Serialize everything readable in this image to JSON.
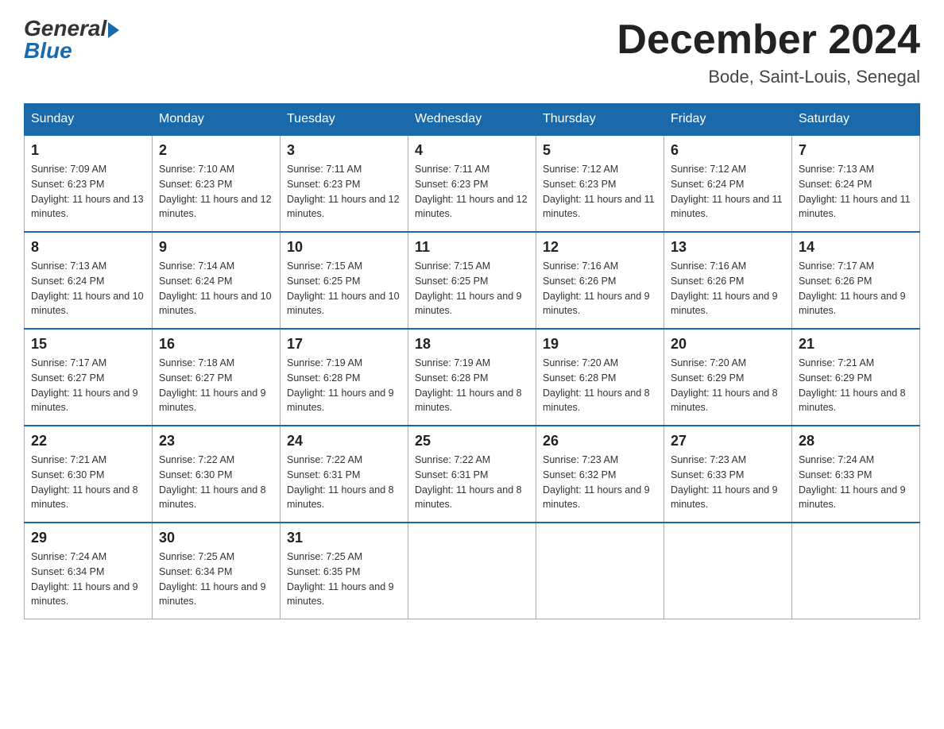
{
  "logo": {
    "general": "General",
    "blue": "Blue"
  },
  "header": {
    "month_year": "December 2024",
    "location": "Bode, Saint-Louis, Senegal"
  },
  "days_of_week": [
    "Sunday",
    "Monday",
    "Tuesday",
    "Wednesday",
    "Thursday",
    "Friday",
    "Saturday"
  ],
  "weeks": [
    [
      {
        "day": "1",
        "sunrise": "7:09 AM",
        "sunset": "6:23 PM",
        "daylight": "11 hours and 13 minutes."
      },
      {
        "day": "2",
        "sunrise": "7:10 AM",
        "sunset": "6:23 PM",
        "daylight": "11 hours and 12 minutes."
      },
      {
        "day": "3",
        "sunrise": "7:11 AM",
        "sunset": "6:23 PM",
        "daylight": "11 hours and 12 minutes."
      },
      {
        "day": "4",
        "sunrise": "7:11 AM",
        "sunset": "6:23 PM",
        "daylight": "11 hours and 12 minutes."
      },
      {
        "day": "5",
        "sunrise": "7:12 AM",
        "sunset": "6:23 PM",
        "daylight": "11 hours and 11 minutes."
      },
      {
        "day": "6",
        "sunrise": "7:12 AM",
        "sunset": "6:24 PM",
        "daylight": "11 hours and 11 minutes."
      },
      {
        "day": "7",
        "sunrise": "7:13 AM",
        "sunset": "6:24 PM",
        "daylight": "11 hours and 11 minutes."
      }
    ],
    [
      {
        "day": "8",
        "sunrise": "7:13 AM",
        "sunset": "6:24 PM",
        "daylight": "11 hours and 10 minutes."
      },
      {
        "day": "9",
        "sunrise": "7:14 AM",
        "sunset": "6:24 PM",
        "daylight": "11 hours and 10 minutes."
      },
      {
        "day": "10",
        "sunrise": "7:15 AM",
        "sunset": "6:25 PM",
        "daylight": "11 hours and 10 minutes."
      },
      {
        "day": "11",
        "sunrise": "7:15 AM",
        "sunset": "6:25 PM",
        "daylight": "11 hours and 9 minutes."
      },
      {
        "day": "12",
        "sunrise": "7:16 AM",
        "sunset": "6:26 PM",
        "daylight": "11 hours and 9 minutes."
      },
      {
        "day": "13",
        "sunrise": "7:16 AM",
        "sunset": "6:26 PM",
        "daylight": "11 hours and 9 minutes."
      },
      {
        "day": "14",
        "sunrise": "7:17 AM",
        "sunset": "6:26 PM",
        "daylight": "11 hours and 9 minutes."
      }
    ],
    [
      {
        "day": "15",
        "sunrise": "7:17 AM",
        "sunset": "6:27 PM",
        "daylight": "11 hours and 9 minutes."
      },
      {
        "day": "16",
        "sunrise": "7:18 AM",
        "sunset": "6:27 PM",
        "daylight": "11 hours and 9 minutes."
      },
      {
        "day": "17",
        "sunrise": "7:19 AM",
        "sunset": "6:28 PM",
        "daylight": "11 hours and 9 minutes."
      },
      {
        "day": "18",
        "sunrise": "7:19 AM",
        "sunset": "6:28 PM",
        "daylight": "11 hours and 8 minutes."
      },
      {
        "day": "19",
        "sunrise": "7:20 AM",
        "sunset": "6:28 PM",
        "daylight": "11 hours and 8 minutes."
      },
      {
        "day": "20",
        "sunrise": "7:20 AM",
        "sunset": "6:29 PM",
        "daylight": "11 hours and 8 minutes."
      },
      {
        "day": "21",
        "sunrise": "7:21 AM",
        "sunset": "6:29 PM",
        "daylight": "11 hours and 8 minutes."
      }
    ],
    [
      {
        "day": "22",
        "sunrise": "7:21 AM",
        "sunset": "6:30 PM",
        "daylight": "11 hours and 8 minutes."
      },
      {
        "day": "23",
        "sunrise": "7:22 AM",
        "sunset": "6:30 PM",
        "daylight": "11 hours and 8 minutes."
      },
      {
        "day": "24",
        "sunrise": "7:22 AM",
        "sunset": "6:31 PM",
        "daylight": "11 hours and 8 minutes."
      },
      {
        "day": "25",
        "sunrise": "7:22 AM",
        "sunset": "6:31 PM",
        "daylight": "11 hours and 8 minutes."
      },
      {
        "day": "26",
        "sunrise": "7:23 AM",
        "sunset": "6:32 PM",
        "daylight": "11 hours and 9 minutes."
      },
      {
        "day": "27",
        "sunrise": "7:23 AM",
        "sunset": "6:33 PM",
        "daylight": "11 hours and 9 minutes."
      },
      {
        "day": "28",
        "sunrise": "7:24 AM",
        "sunset": "6:33 PM",
        "daylight": "11 hours and 9 minutes."
      }
    ],
    [
      {
        "day": "29",
        "sunrise": "7:24 AM",
        "sunset": "6:34 PM",
        "daylight": "11 hours and 9 minutes."
      },
      {
        "day": "30",
        "sunrise": "7:25 AM",
        "sunset": "6:34 PM",
        "daylight": "11 hours and 9 minutes."
      },
      {
        "day": "31",
        "sunrise": "7:25 AM",
        "sunset": "6:35 PM",
        "daylight": "11 hours and 9 minutes."
      },
      null,
      null,
      null,
      null
    ]
  ]
}
